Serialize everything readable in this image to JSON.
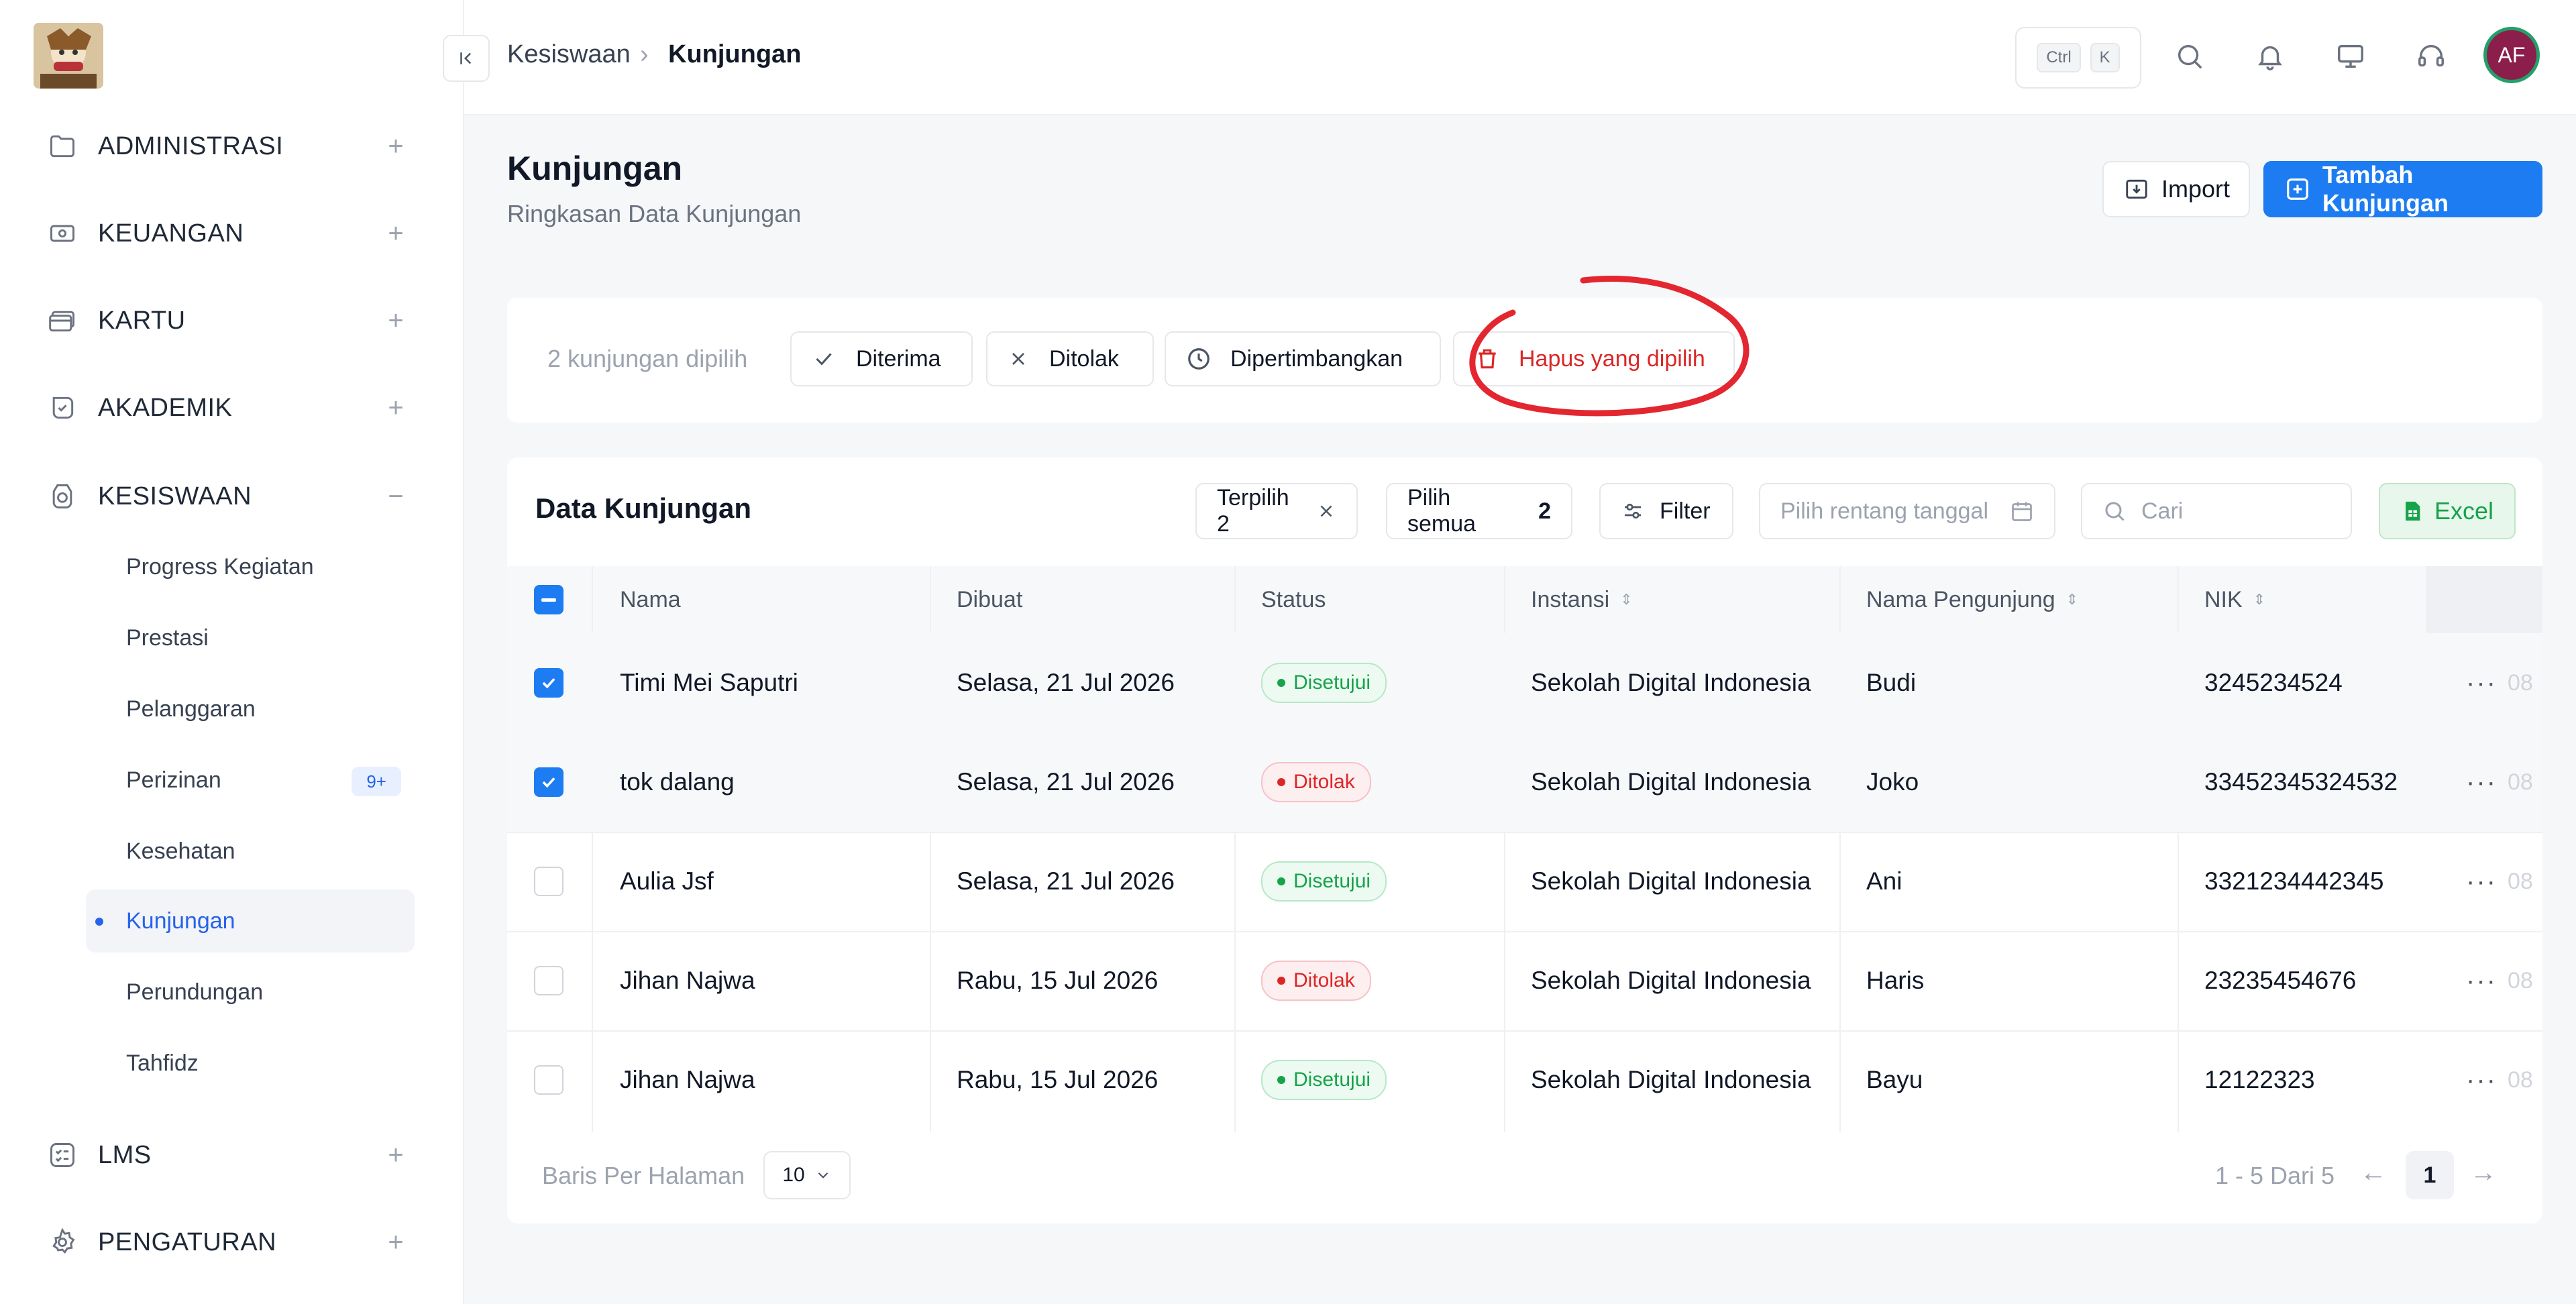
{
  "sidebar": {
    "groups": [
      {
        "label": "ADMINISTRASI",
        "toggle": "+",
        "icon": "folder-icon"
      },
      {
        "label": "KEUANGAN",
        "toggle": "+",
        "icon": "money-icon"
      },
      {
        "label": "KARTU",
        "toggle": "+",
        "icon": "card-icon"
      },
      {
        "label": "AKADEMIK",
        "toggle": "+",
        "icon": "academic-icon"
      },
      {
        "label": "KESISWAAN",
        "toggle": "−",
        "icon": "student-icon"
      },
      {
        "label": "LMS",
        "toggle": "+",
        "icon": "checklist-icon"
      },
      {
        "label": "PENGATURAN",
        "toggle": "+",
        "icon": "gear-icon"
      }
    ],
    "kesiswaan_items": [
      {
        "label": "Progress Kegiatan"
      },
      {
        "label": "Prestasi"
      },
      {
        "label": "Pelanggaran"
      },
      {
        "label": "Perizinan",
        "badge": "9+"
      },
      {
        "label": "Kesehatan"
      },
      {
        "label": "Kunjungan",
        "active": true
      },
      {
        "label": "Perundungan"
      },
      {
        "label": "Tahfidz"
      }
    ]
  },
  "topbar": {
    "breadcrumb": [
      "Kesiswaan",
      "Kunjungan"
    ],
    "shortcut": [
      "Ctrl",
      "K"
    ],
    "avatar_initials": "AF"
  },
  "header": {
    "title": "Kunjungan",
    "subtitle": "Ringkasan Data Kunjungan",
    "import_label": "Import",
    "add_label": "Tambah Kunjungan"
  },
  "bulk": {
    "selected_text": "2 kunjungan dipilih",
    "accept_label": "Diterima",
    "reject_label": "Ditolak",
    "consider_label": "Dipertimbangkan",
    "delete_label": "Hapus yang dipilih"
  },
  "table": {
    "title": "Data Kunjungan",
    "selected_label": "Terpilih 2",
    "select_all_label": "Pilih semua",
    "select_all_count": "2",
    "filter_label": "Filter",
    "date_placeholder": "Pilih rentang tanggal",
    "search_placeholder": "Cari",
    "excel_label": "Excel",
    "columns": [
      "Nama",
      "Dibuat",
      "Status",
      "Instansi",
      "Nama Pengunjung",
      "NIK"
    ],
    "rows": [
      {
        "nama": "Timi Mei Saputri",
        "dibuat": "Selasa, 21 Jul 2026",
        "status": "Disetujui",
        "instansi": "Sekolah Digital Indonesia",
        "pengunjung": "Budi",
        "nik": "3245234524",
        "checked": true,
        "ghost": "08"
      },
      {
        "nama": "tok dalang",
        "dibuat": "Selasa, 21 Jul 2026",
        "status": "Ditolak",
        "instansi": "Sekolah Digital Indonesia",
        "pengunjung": "Joko",
        "nik": "33452345324532",
        "checked": true,
        "ghost": "08"
      },
      {
        "nama": "Aulia Jsf",
        "dibuat": "Selasa, 21 Jul 2026",
        "status": "Disetujui",
        "instansi": "Sekolah Digital Indonesia",
        "pengunjung": "Ani",
        "nik": "3321234442345",
        "checked": false,
        "ghost": "08"
      },
      {
        "nama": "Jihan Najwa",
        "dibuat": "Rabu, 15 Jul 2026",
        "status": "Ditolak",
        "instansi": "Sekolah Digital Indonesia",
        "pengunjung": "Haris",
        "nik": "23235454676",
        "checked": false,
        "ghost": "08"
      },
      {
        "nama": "Jihan Najwa",
        "dibuat": "Rabu, 15 Jul 2026",
        "status": "Disetujui",
        "instansi": "Sekolah Digital Indonesia",
        "pengunjung": "Bayu",
        "nik": "12122323",
        "checked": false,
        "ghost": "08"
      }
    ]
  },
  "pagination": {
    "rows_label": "Baris Per Halaman",
    "per_page": "10",
    "range": "1 - 5 Dari 5",
    "current_page": "1"
  },
  "colors": {
    "primary": "#1e7cf2",
    "annotation": "#e3262f",
    "success": "#16a34a",
    "danger": "#dc2626"
  }
}
